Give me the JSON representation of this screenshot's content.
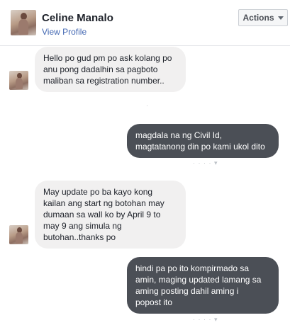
{
  "header": {
    "name": "Celine Manalo",
    "profile_link": "View Profile",
    "actions_label": "Actions"
  },
  "messages": [
    {
      "direction": "incoming",
      "text": "Hello po gud pm po ask kolang po\nanu pong dadalhin sa pagboto\nmaliban sa registration number.."
    },
    {
      "direction": "outgoing",
      "text": "magdala na ng Civil Id,\nmagtatanong din po kami ukol dito"
    },
    {
      "direction": "incoming",
      "text": "May update po ba kayo kong\nkailan ang start ng botohan may\ndumaan sa wall ko  by April 9 to\nmay 9 ang simula ng\nbutohan..thanks po"
    },
    {
      "direction": "outgoing",
      "text": "hindi pa po ito kompirmado sa\namin, maging updated lamang sa\naming posting dahil aming i\npopost ito"
    }
  ]
}
